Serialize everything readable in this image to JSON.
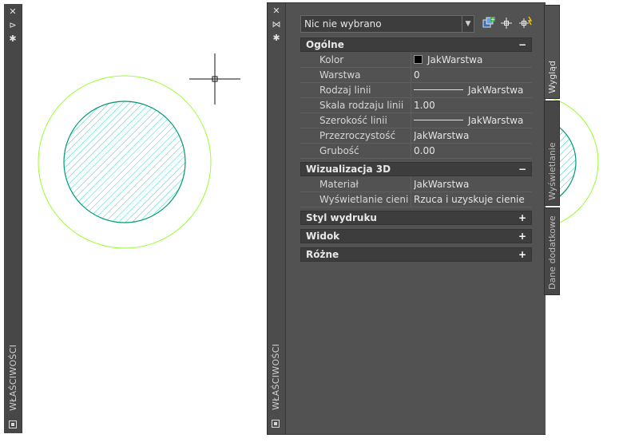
{
  "left_palette": {
    "close_glyph": "✕",
    "pin_glyph": "⊳",
    "settings_glyph": "✱",
    "title": "WŁAŚCIWOŚCI"
  },
  "properties_palette": {
    "close_glyph": "✕",
    "pin_glyph": "⋈",
    "settings_glyph": "✱",
    "title": "WŁAŚCIWOŚCI",
    "selector": {
      "value": "Nic nie wybrano"
    },
    "toolbar": {
      "select_objects_icon": "select-objects-icon",
      "pick_add_icon": "pick-add-icon",
      "quick_select_icon": "quick-select-icon"
    },
    "sections": {
      "general": {
        "title": "Ogólne",
        "toggle": "−",
        "rows": [
          {
            "name": "Kolor",
            "value": "JakWarstwa"
          },
          {
            "name": "Warstwa",
            "value": "0"
          },
          {
            "name": "Rodzaj linii",
            "value": "JakWarstwa"
          },
          {
            "name": "Skala rodzaju linii",
            "value": "1.00"
          },
          {
            "name": "Szerokość linii",
            "value": "JakWarstwa"
          },
          {
            "name": "Przezroczystość",
            "value": "JakWarstwa"
          },
          {
            "name": "Grubość",
            "value": "0.00"
          }
        ]
      },
      "visualization": {
        "title": "Wizualizacja 3D",
        "toggle": "−",
        "rows": [
          {
            "name": "Materiał",
            "value": "JakWarstwa"
          },
          {
            "name": "Wyświetlanie cieni",
            "value": "Rzuca i uzyskuje cienie"
          }
        ]
      },
      "plot_style": {
        "title": "Styl wydruku",
        "toggle": "+"
      },
      "view": {
        "title": "Widok",
        "toggle": "+"
      },
      "misc": {
        "title": "Różne",
        "toggle": "+"
      }
    },
    "tabs": [
      "Wygląd",
      "Wyświetlanie",
      "Dane dodatkowe"
    ]
  },
  "colors": {
    "palette_bg": "#525252",
    "outer_circle": "#99ff33",
    "inner_circle": "#009977",
    "hatch": "#33cccc"
  }
}
